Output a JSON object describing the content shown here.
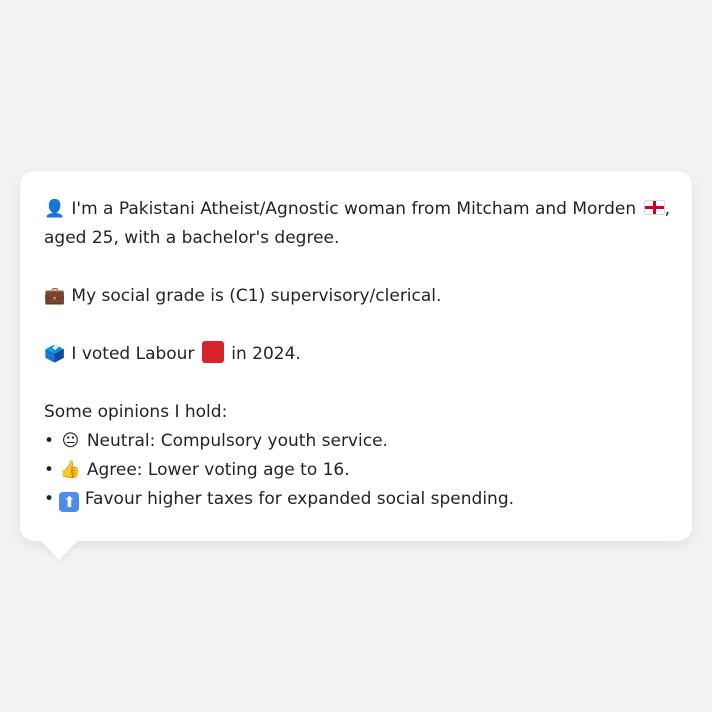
{
  "profile": {
    "intro_line1": "I'm a Pakistani Atheist/Agnostic woman from Mitcham and Morden",
    "intro_line1_suffix": ",",
    "intro_line2": "aged 25, with a bachelor's degree.",
    "grade": "My social grade is (C1) supervisory/clerical.",
    "vote_prefix": "I voted Labour",
    "vote_suffix": "in 2024.",
    "opinions_heading": "Some opinions I hold:",
    "opinions": [
      {
        "bullet": "•",
        "text": "Neutral: Compulsory youth service."
      },
      {
        "bullet": "•",
        "text": "Agree: Lower voting age to 16."
      },
      {
        "bullet": "•",
        "text": "Favour higher taxes for expanded social spending."
      }
    ]
  },
  "icons": {
    "person": "👤",
    "briefcase": "💼",
    "ballot": "🗳️",
    "neutral": "😐",
    "thumbs_up": "👍",
    "arrow_up": "⬆"
  },
  "colors": {
    "background": "#f2f3f5",
    "bubble": "#ffffff",
    "text": "#1f2328",
    "labour_red": "#d9232c",
    "arrow_blue": "#4e8de6"
  }
}
